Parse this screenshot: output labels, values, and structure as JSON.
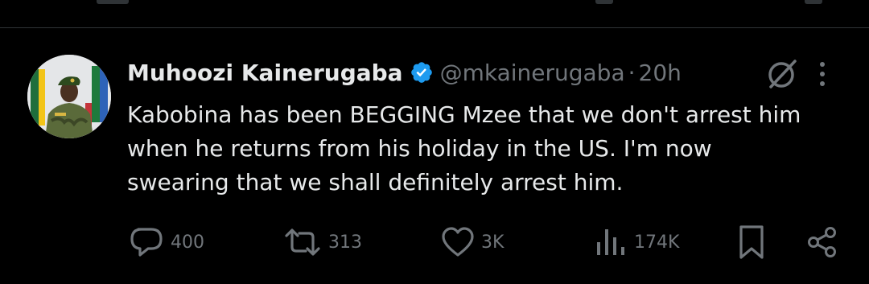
{
  "tweet": {
    "author_name": "Muhoozi Kainerugaba",
    "handle": "@mkainerugaba",
    "separator": "·",
    "time": "20h",
    "text_lines": [
      "Kabobina has been BEGGING Mzee that we don't arrest him",
      "when he returns from his holiday in the US. I'm now",
      "swearing that we shall definitely arrest him."
    ]
  },
  "actions": {
    "replies": "400",
    "reposts": "313",
    "likes": "3K",
    "views": "174K"
  },
  "icons": {
    "verified": "verified-badge-icon",
    "grok": "grok-icon",
    "more": "more-options-icon",
    "reply": "reply-icon",
    "repost": "repost-icon",
    "like": "heart-icon",
    "views": "views-icon",
    "bookmark": "bookmark-icon",
    "share": "share-icon"
  },
  "colors": {
    "background": "#000000",
    "text": "#e7e9ea",
    "secondary": "#71767b",
    "verified": "#1d9bf0",
    "divider": "#2f3336"
  }
}
